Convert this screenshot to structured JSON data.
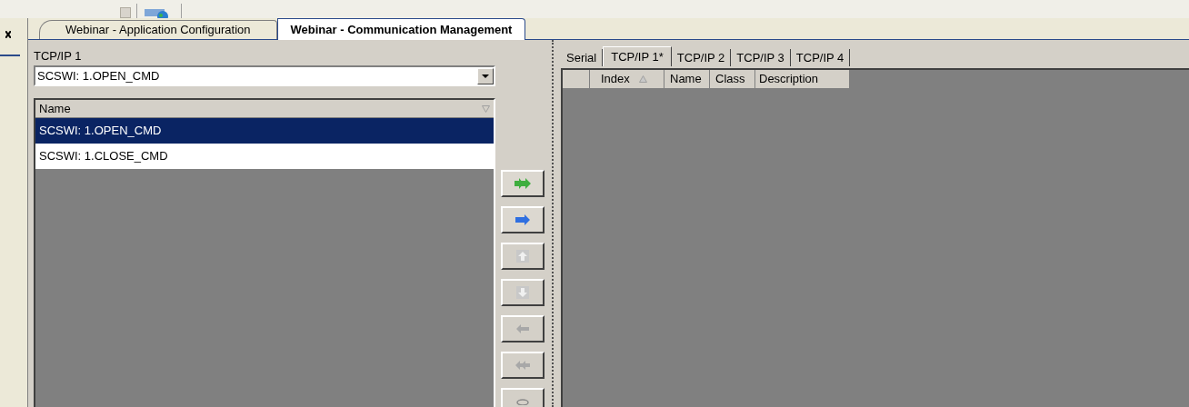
{
  "tabs": [
    {
      "label": "Webinar - Application Configuration",
      "selected": false
    },
    {
      "label": "Webinar - Communication Management",
      "selected": true
    }
  ],
  "left": {
    "title": "TCP/IP 1",
    "combo": {
      "value": "SCSWI: 1.OPEN_CMD"
    },
    "list": {
      "column": "Name",
      "rows": [
        {
          "name": "SCSWI: 1.OPEN_CMD",
          "selected": true
        },
        {
          "name": "SCSWI: 1.CLOSE_CMD",
          "selected": false
        }
      ]
    }
  },
  "move_buttons": [
    {
      "kind": "add_all",
      "disabled": false
    },
    {
      "kind": "add",
      "disabled": false
    },
    {
      "kind": "up",
      "disabled": true
    },
    {
      "kind": "down",
      "disabled": true
    },
    {
      "kind": "remove",
      "disabled": true
    },
    {
      "kind": "remove_all",
      "disabled": true
    },
    {
      "kind": "clear",
      "disabled": true
    }
  ],
  "right": {
    "tabs": [
      {
        "label": "Serial",
        "selected": false
      },
      {
        "label": "TCP/IP 1*",
        "selected": true
      },
      {
        "label": "TCP/IP 2",
        "selected": false
      },
      {
        "label": "TCP/IP 3",
        "selected": false
      },
      {
        "label": "TCP/IP 4",
        "selected": false
      }
    ],
    "columns": [
      "Index",
      "Name",
      "Class",
      "Description"
    ]
  }
}
